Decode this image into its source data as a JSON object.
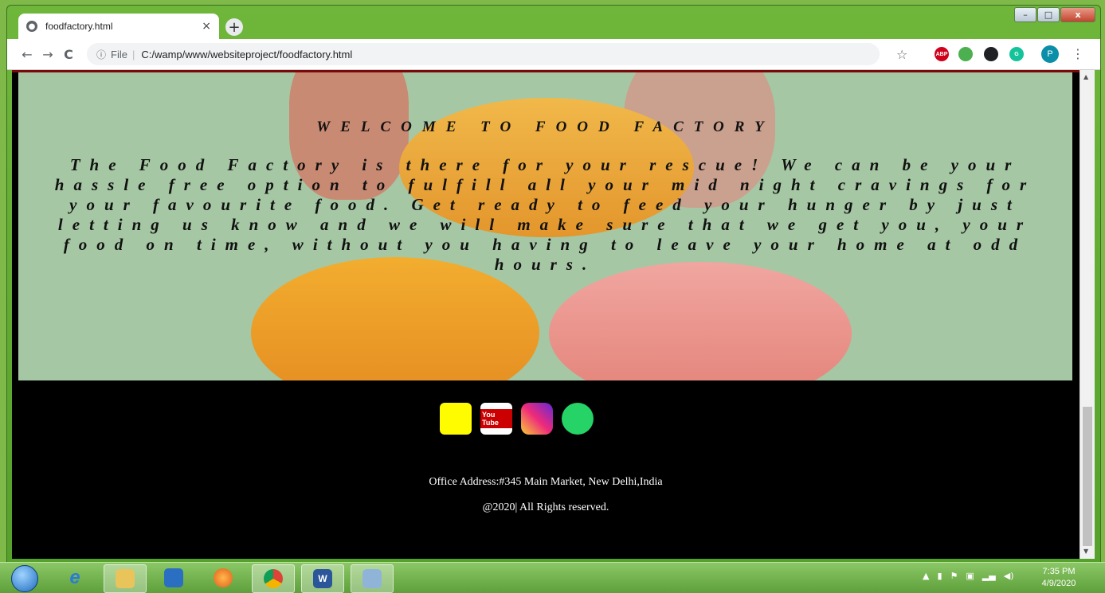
{
  "browser": {
    "tab_title": "foodfactory.html",
    "tab_close": "×",
    "new_tab": "+",
    "back": "←",
    "forward": "→",
    "reload": "C",
    "info_icon": "ⓘ",
    "scheme": "File",
    "url": "C:/wamp/www/websiteproject/foodfactory.html",
    "star": "☆",
    "profile_initial": "P",
    "menu": "⋮",
    "extensions": [
      {
        "name": "abp-icon",
        "label": "ABP",
        "color": "#d0021b"
      },
      {
        "name": "shield-icon",
        "label": "",
        "color": "#4caf50"
      },
      {
        "name": "glasses-icon",
        "label": "",
        "color": "#202124"
      },
      {
        "name": "grammarly-icon",
        "label": "G",
        "color": "#15c39a"
      }
    ]
  },
  "window": {
    "minimize": "–",
    "maximize": "□",
    "close": "x"
  },
  "hero": {
    "welcome": "WELCOME TO FOOD FACTORY",
    "description": "The Food Factory is there for your rescue! We can be your hassle free option to fulfill all your mid night cravings for your favourite food. Get ready to feed your hunger by just letting us know and we will make sure that we get you, your food on time, without you having to leave your home at odd hours."
  },
  "footer": {
    "social": [
      {
        "name": "snapchat-icon",
        "label": "",
        "color": "#fffc00"
      },
      {
        "name": "youtube-icon",
        "label": "You Tube",
        "color": "#ffffff"
      },
      {
        "name": "instagram-icon",
        "label": "",
        "color": "#c13584"
      },
      {
        "name": "whatsapp-icon",
        "label": "",
        "color": "#25d366"
      },
      {
        "name": "twitter-icon",
        "label": "",
        "color": "#1da1f2"
      }
    ],
    "address": "Office Address:#345 Main Market, New Delhi,India",
    "rights": "@2020| All Rights reserved."
  },
  "taskbar": {
    "time": "7:35 PM",
    "date": "4/9/2020"
  }
}
